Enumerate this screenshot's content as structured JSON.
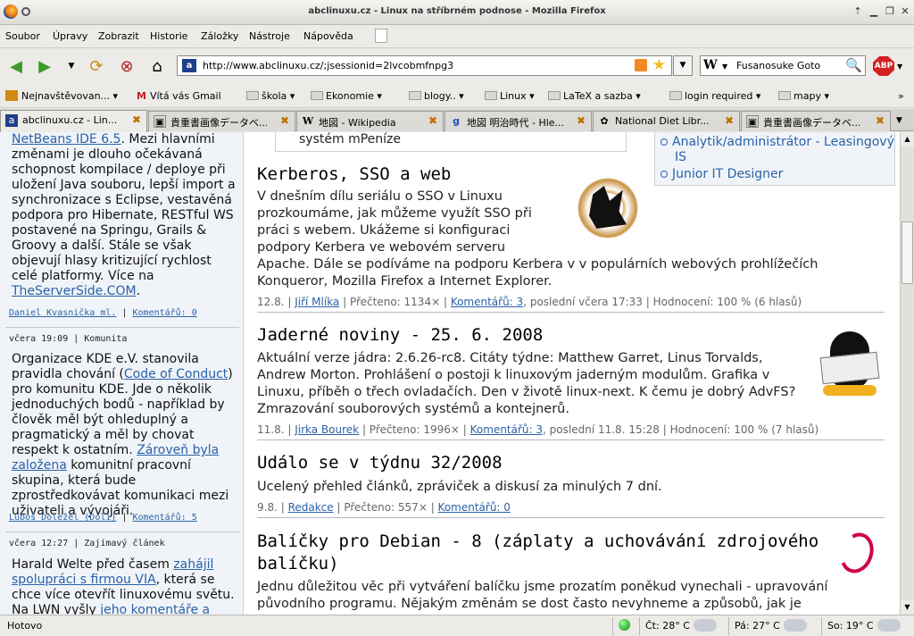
{
  "window": {
    "title": "abclinuxu.cz - Linux na stříbrném podnose - Mozilla Firefox"
  },
  "menu": [
    "Soubor",
    "Úpravy",
    "Zobrazit",
    "Historie",
    "Záložky",
    "Nástroje",
    "Nápověda"
  ],
  "navbar": {
    "url": "http://www.abclinuxu.cz/;jsessionid=2lvcobmfnpg3",
    "search_engine": "W",
    "search_query": "Fusanosuke Goto",
    "adblock_label": "ABP"
  },
  "bookmarks": [
    "Nejnavštěvovan...",
    "Vítá vás Gmail",
    "škola",
    "Ekonomie",
    "blogy..",
    "Linux",
    "LaTeX a sazba",
    "login required",
    "mapy"
  ],
  "tabs": [
    {
      "label": "abclinuxu.cz - Lin...",
      "icon": "abc-favicon",
      "active": true
    },
    {
      "label": "貴重書画像データベ...",
      "icon": "ndl-favicon"
    },
    {
      "label": "地図 - Wikipedia",
      "icon": "wikipedia-favicon"
    },
    {
      "label": "地図 明治時代 - Hle...",
      "icon": "google-favicon"
    },
    {
      "label": "National Diet Libr...",
      "icon": "ndl-flower-favicon"
    },
    {
      "label": "貴重書画像データベ...",
      "icon": "ndl-favicon"
    }
  ],
  "sidebar": {
    "news1": {
      "link_top": "NetBeans IDE 6.5",
      "text": ". Mezi hlavními změnami je dlouho očekávaná schopnost kompilace / deploye při uložení Java souboru, lepší import a synchronizace s Eclipse, vestavěná podpora pro Hibernate, RESTful WS postavené na Springu, Grails & Groovy a další. Stále se však objevují hlasy kritizující rychlost celé platformy. Více na ",
      "link_bottom": "TheServerSide.COM",
      "end": ".",
      "author": "Daniel Kvasnička ml.",
      "comments": "Komentářů: 0"
    },
    "news2": {
      "header": "včera 19:09 | Komunita",
      "text_a": "Organizace KDE e.V. stanovila pravidla chování (",
      "link_a": "Code of Conduct",
      "text_b": ") pro komunitu KDE. Jde o několik jednoduchých bodů - například by člověk měl být ohleduplný a pragmatický a měl by chovat respekt k ostatním. ",
      "link_b": "Zároveň byla založena",
      "text_c": " komunitní pracovní skupina, která bude zprostředkovávat komunikaci mezi uživateli a vývojáři.",
      "author": "Luboš Doležel (Doli)",
      "comments": "Komentářů: 5"
    },
    "news3": {
      "header": "včera 12:27 | Zajímavý článek",
      "text_a": "Harald Welte před časem ",
      "link_a": "zahájil spolupráci s firmou VIA",
      "text_b": ", která se chce více otevřít linuxovému světu. Na LWN vyšly ",
      "link_b": "jeho komentáře a"
    }
  },
  "main": {
    "prev_item": "systém mPeníze",
    "jobs": [
      "Analytik/administrátor - Leasingový IS",
      "Junior IT Designer"
    ],
    "articles": [
      {
        "title": "Kerberos, SSO a web",
        "text": "V dnešním dílu seriálu o SSO v Linuxu prozkoumáme, jak můžeme využít SSO při práci s webem. Ukážeme si konfiguraci podpory Kerbera ve webovém serveru Apache. Dále se podíváme na podporu Kerbera v v populárních webových prohlížečích Konqueror, Mozilla Firefox a Internet Explorer.",
        "date": "12.8.",
        "author": "Jiří Mlíka",
        "reads": "Přečteno: 1134×",
        "comments": "Komentářů: 3",
        "rest": "poslední včera 17:33 | Hodnocení: 100 % (6 hlasů)"
      },
      {
        "title": "Jaderné noviny - 25. 6. 2008",
        "text": "Aktuální verze jádra: 2.6.26-rc8. Citáty týdne: Matthew Garret, Linus Torvalds, Andrew Morton. Prohlášení o postoji k linuxovým jaderným modulům. Grafika v Linuxu, příběh o třech ovladačích. Den v životě linux-next. K čemu je dobrý AdvFS? Zmrazování souborových systémů a kontejnerů.",
        "date": "11.8.",
        "author": "Jirka Bourek",
        "reads": "Přečteno: 1996×",
        "comments": "Komentářů: 3",
        "rest": "poslední 11.8. 15:28 | Hodnocení: 100 % (7 hlasů)"
      },
      {
        "title": "Událo se v týdnu 32/2008",
        "text": "Ucelený přehled článků, zpráviček a diskusí za minulých 7 dní.",
        "date": "9.8.",
        "author": "Redakce",
        "reads": "Přečteno: 557×",
        "comments": "Komentářů: 0"
      },
      {
        "title": "Balíčky pro Debian - 8 (záplaty a uchovávání zdrojového balíčku)",
        "text": "Jednu důležitou věc při vytváření balíčku jsme prozatím poněkud vynechali - upravování původního programu. Nějakým změnám se dost často nevyhneme a způsobů, jak je"
      }
    ]
  },
  "statusbar": {
    "text": "Hotovo",
    "weather": [
      "Čt: 28° C",
      "Pá: 27° C",
      "So: 19° C"
    ]
  }
}
